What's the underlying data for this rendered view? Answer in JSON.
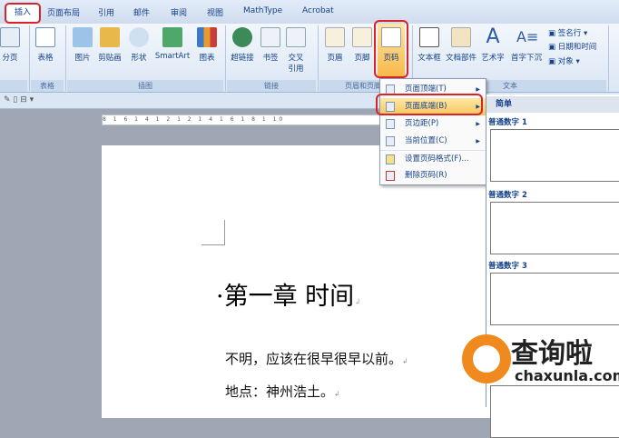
{
  "tabs": {
    "active": "插入",
    "items": [
      "页面布局",
      "引用",
      "邮件",
      "审阅",
      "视图",
      "MathType",
      "Acrobat"
    ]
  },
  "ribbon": {
    "buttons": [
      "分页",
      "表格",
      "图片",
      "剪贴画",
      "形状",
      "SmartArt",
      "图表",
      "超链接",
      "书签",
      "交叉引用",
      "页眉",
      "页脚",
      "页码",
      "文本框",
      "文档部件",
      "艺术字",
      "首字下沉"
    ],
    "small": [
      "签名行",
      "日期和时间",
      "对象"
    ],
    "groups": [
      "表格",
      "插图",
      "链接",
      "页眉和页脚",
      "文本"
    ]
  },
  "menu": {
    "items": [
      "页面顶端(T)",
      "页面底端(B)",
      "页边距(P)",
      "当前位置(C)",
      "设置页码格式(F)...",
      "删除页码(R)"
    ]
  },
  "gallery": {
    "header": "简单",
    "sections": [
      "普通数字 1",
      "普通数字 2",
      "普通数字 3"
    ]
  },
  "ruler": "8 1 6 1 4 1 2 1 2 1 4 1 6 1 8 1 10",
  "document": {
    "title": "第一章  时间",
    "lines": [
      "不明，应该在很早很早以前。",
      "地点：神州浩土。"
    ]
  },
  "watermark": {
    "name": "查询啦",
    "url": "chaxunla.com"
  },
  "colors": {
    "highlight": "#d8232a",
    "accent": "#15428b",
    "selected": "#fbd26b"
  }
}
